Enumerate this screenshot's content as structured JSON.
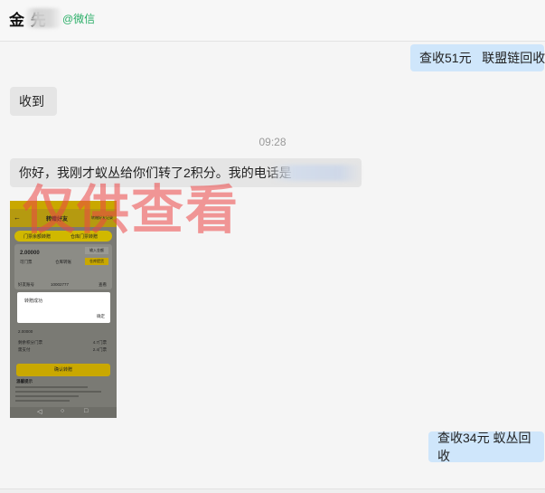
{
  "header": {
    "contact_name": "金 先",
    "contact_tag": "@微信"
  },
  "messages": [
    {
      "side": "right",
      "text": "查收51元   联盟链回收"
    },
    {
      "side": "left",
      "text": "收到"
    },
    {
      "side": "left",
      "text": "你好，我刚才蚁丛给你们转了2积分。我的电话是"
    },
    {
      "side": "right",
      "text": "查收34元 蚁丛回收"
    }
  ],
  "timestamp": "09:28",
  "watermark": "仅供查看",
  "thumbnail": {
    "title": "转赠好友",
    "top_right": "转赠好友记录",
    "tab_left": "门票余额转赠",
    "tab_right": "仓库门票转赠",
    "amount": "2.00000",
    "btn_top": "输入金额",
    "btn_action": "仓库提货",
    "row1_left": "可门票",
    "row1_right": "仓库转账",
    "friend_label": "好友账号",
    "friend_value": "10002777",
    "friend_right": "查看",
    "dialog_title": "转赠成功",
    "dialog_ok": "确定",
    "value2": "2.00000",
    "line_a_left": "剩余积分门票",
    "line_a_right": "4.7门票",
    "line_b_left": "需支付",
    "line_b_right": "2.4门票",
    "confirm": "确认转赠",
    "notes_title": "温馨提示",
    "nav_back": "◁",
    "nav_home": "○",
    "nav_recent": "□"
  }
}
